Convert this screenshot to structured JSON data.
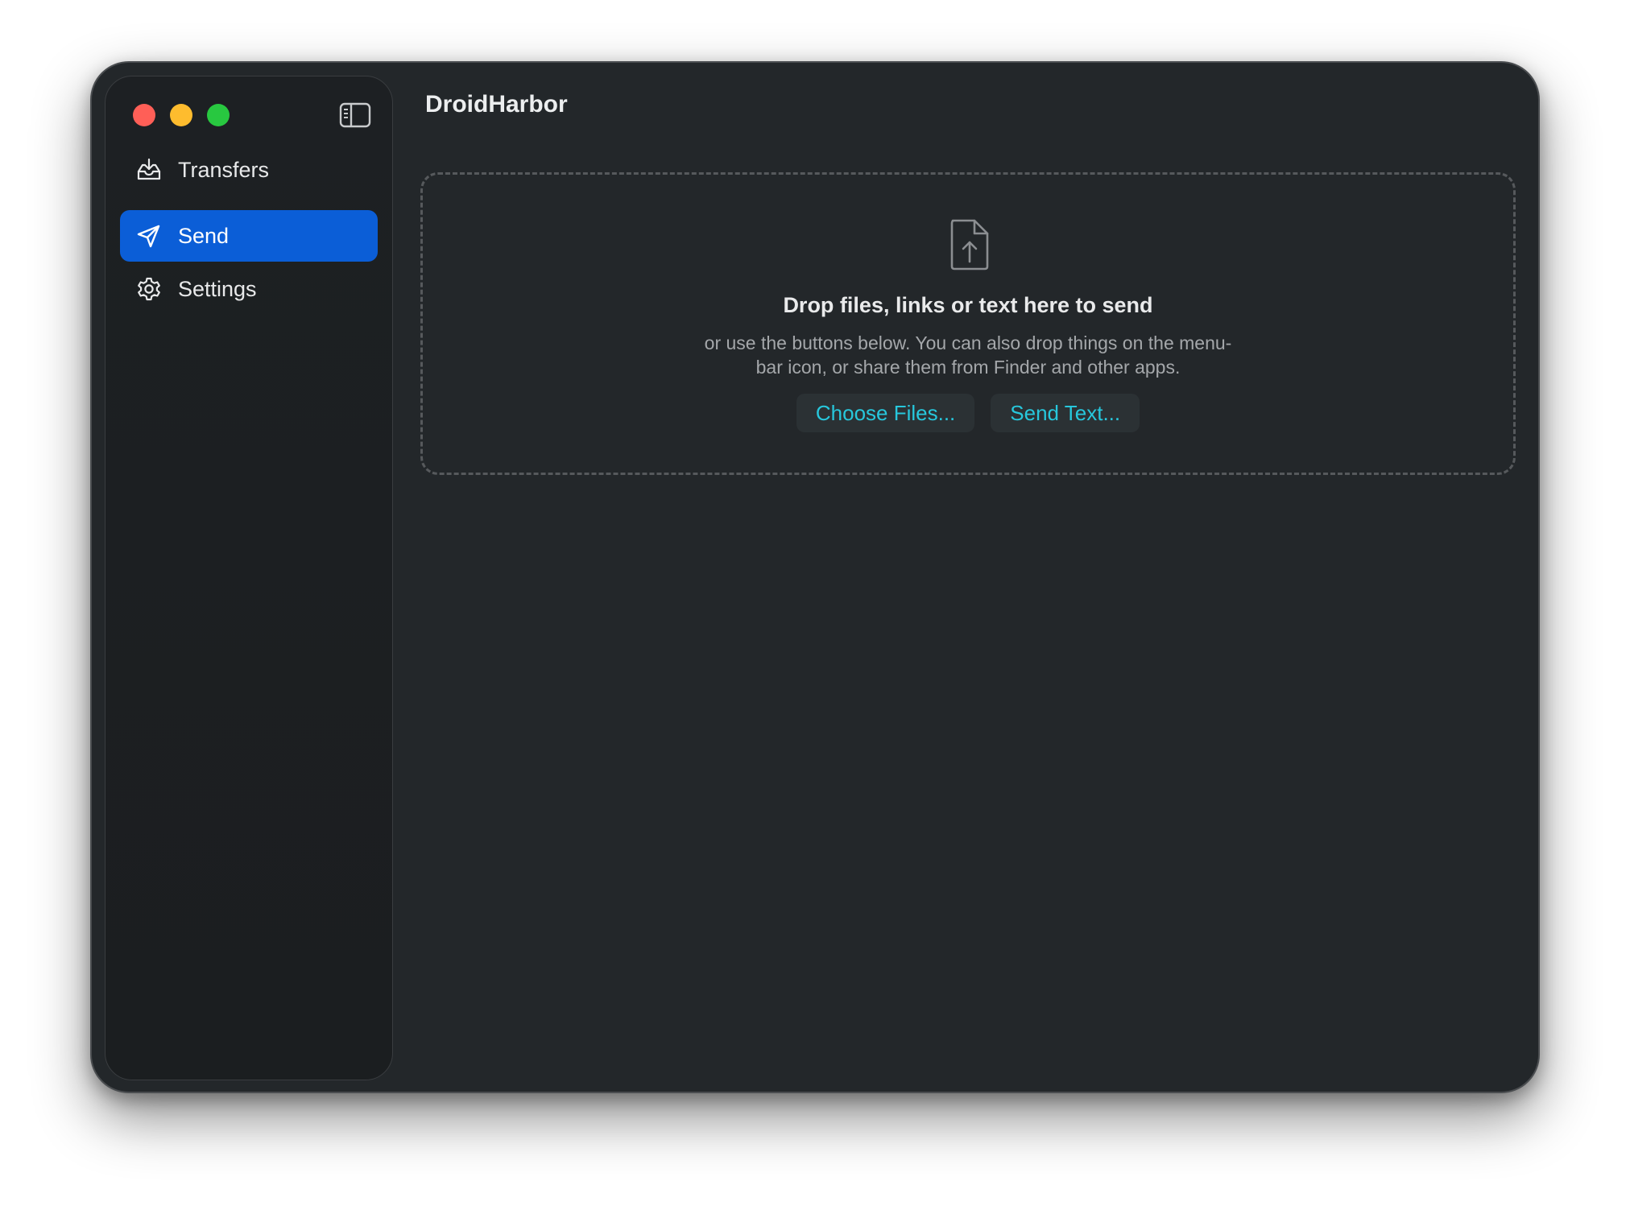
{
  "app": {
    "title": "DroidHarbor"
  },
  "sidebar": {
    "items": [
      {
        "label": "Transfers",
        "icon": "tray-download-icon",
        "active": false
      },
      {
        "label": "Send",
        "icon": "paper-plane-icon",
        "active": true
      },
      {
        "label": "Settings",
        "icon": "gear-icon",
        "active": false
      }
    ]
  },
  "dropzone": {
    "icon": "document-upload-icon",
    "title": "Drop files, links or text here to send",
    "subtitle_line1": "or use the buttons below. You can also drop things on the menu-",
    "subtitle_line2": "bar icon, or share them from Finder and other apps.",
    "buttons": {
      "choose_files": "Choose Files...",
      "send_text": "Send Text..."
    }
  },
  "colors": {
    "accent": "#0b5ed7",
    "link": "#27c7dc",
    "window_bg": "#23272a",
    "sidebar_bg": "#1d2023",
    "traffic_red": "#ff5f57",
    "traffic_yellow": "#febc2e",
    "traffic_green": "#28c840"
  }
}
